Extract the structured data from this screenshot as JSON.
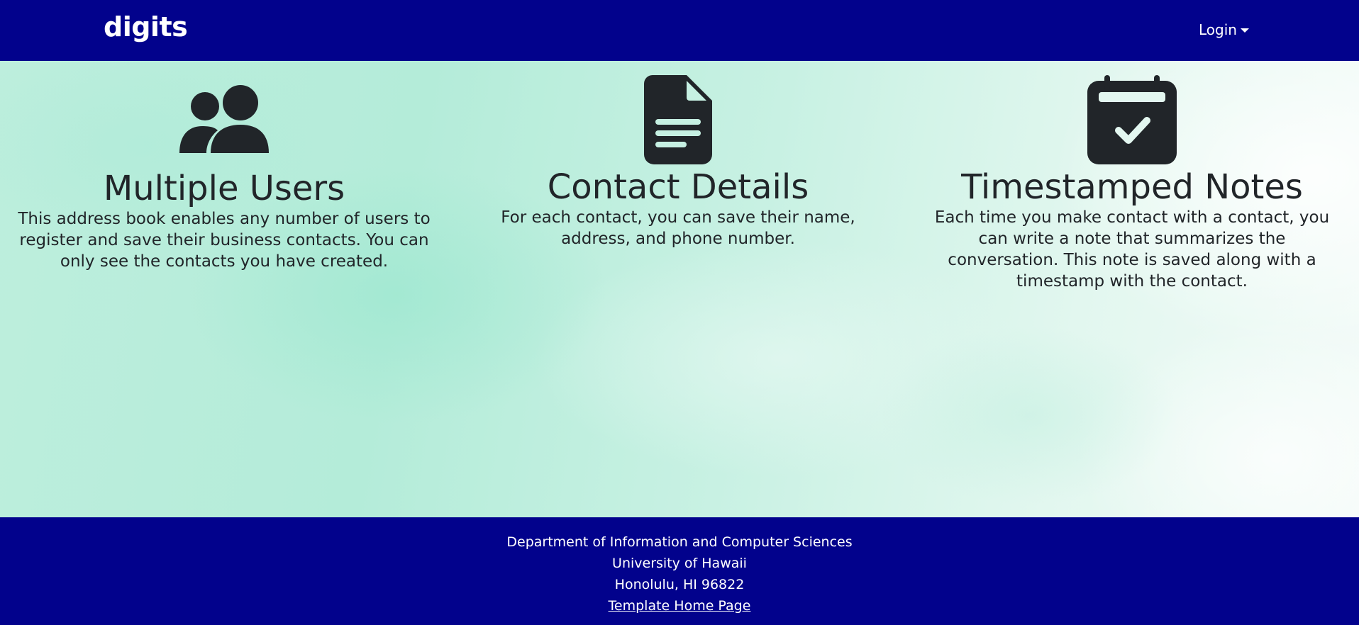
{
  "navbar": {
    "brand": "digits",
    "login_label": "Login"
  },
  "features": [
    {
      "icon": "users-icon",
      "title": "Multiple Users",
      "description": "This address book enables any number of users to register and save their business contacts. You can only see the contacts you have created."
    },
    {
      "icon": "file-text-icon",
      "title": "Contact Details",
      "description": "For each contact, you can save their name, address, and phone number."
    },
    {
      "icon": "calendar-check-icon",
      "title": "Timestamped Notes",
      "description": "Each time you make contact with a contact, you can write a note that summarizes the conversation. This note is saved along with a timestamp with the contact."
    }
  ],
  "footer": {
    "line1": "Department of Information and Computer Sciences",
    "line2": "University of Hawaii",
    "line3": "Honolulu, HI 96822",
    "link_label": "Template Home Page"
  },
  "colors": {
    "navbar_bg": "#02028c",
    "text_dark": "#212529",
    "background_accent": "#b4ecd9"
  }
}
